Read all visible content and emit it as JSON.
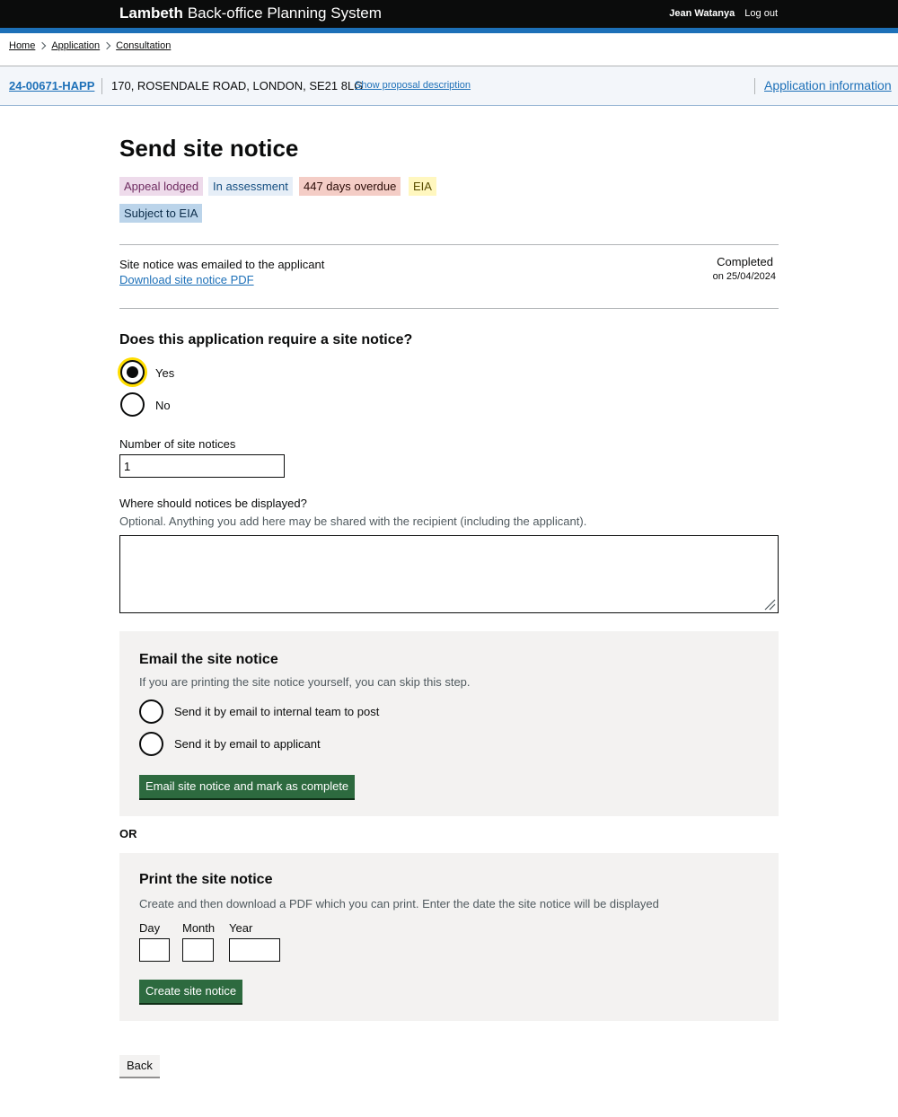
{
  "header": {
    "org": "Lambeth",
    "service": "Back-office Planning System",
    "user_name": "Jean Watanya",
    "logout": "Log out"
  },
  "breadcrumbs": [
    "Home",
    "Application",
    "Consultation"
  ],
  "application": {
    "reference": "24-00671-HAPP",
    "address": "170, ROSENDALE ROAD, LONDON, SE21 8LG",
    "show_description": "Show proposal description",
    "info_link": "Application information"
  },
  "page": {
    "title": "Send site notice",
    "tags": [
      "Appeal lodged",
      "In assessment",
      "447 days overdue",
      "EIA",
      "Subject to EIA"
    ]
  },
  "summary": {
    "text": "Site notice was emailed to the applicant",
    "link": "Download site notice PDF",
    "status": "Completed",
    "date": "on 25/04/2024"
  },
  "requirement": {
    "question": "Does this application require a site notice?",
    "options": [
      {
        "label": "Yes",
        "selected": true
      },
      {
        "label": "No",
        "selected": false
      }
    ]
  },
  "number_field": {
    "label": "Number of site notices",
    "value": "1"
  },
  "display_field": {
    "label": "Where should notices be displayed?",
    "hint": "Optional. Anything you add here may be shared with the recipient (including the applicant).",
    "value": ""
  },
  "email_panel": {
    "title": "Email the site notice",
    "hint": "If you are printing the site notice yourself, you can skip this step.",
    "options": [
      {
        "label": "Send it by email to internal team to post",
        "selected": false
      },
      {
        "label": "Send it by email to applicant",
        "selected": false
      }
    ],
    "button": "Email site notice and mark as complete"
  },
  "or_text": "OR",
  "print_panel": {
    "title": "Print the site notice",
    "hint": "Create and then download a PDF which you can print. Enter the date the site notice will be displayed",
    "day_label": "Day",
    "month_label": "Month",
    "year_label": "Year",
    "button": "Create site notice"
  },
  "back_button": "Back",
  "colors": {
    "header_bg": "#0b0c0c",
    "accent_blue": "#1d70b8",
    "button_green": "#2d6a3f",
    "focus_yellow": "#ffdd00"
  }
}
